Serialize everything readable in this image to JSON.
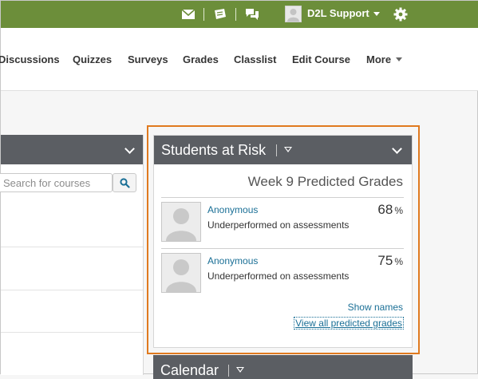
{
  "minibar": {
    "user_name": "D2L Support",
    "icons": [
      "message-alert-icon",
      "update-alert-icon",
      "subscription-alert-icon",
      "settings-gear-icon"
    ]
  },
  "navbar": {
    "items": [
      "Discussions",
      "Quizzes",
      "Surveys",
      "Grades",
      "Classlist",
      "Edit Course",
      "More"
    ]
  },
  "left_widget": {
    "search_placeholder": "Search for courses"
  },
  "students_at_risk": {
    "title": "Students at Risk",
    "subtitle": "Week 9 Predicted Grades",
    "students": [
      {
        "name": "Anonymous",
        "reason": "Underperformed on assessments",
        "grade": "68",
        "unit": "%"
      },
      {
        "name": "Anonymous",
        "reason": "Underperformed on assessments",
        "grade": "75",
        "unit": "%"
      }
    ],
    "show_names_label": "Show names",
    "view_all_label": "View all predicted grades"
  },
  "calendar": {
    "title": "Calendar"
  },
  "colors": {
    "minibar": "#6c8e3a",
    "widget_header": "#5b5e63",
    "highlight": "#e07a1f",
    "link": "#1a6f96"
  }
}
